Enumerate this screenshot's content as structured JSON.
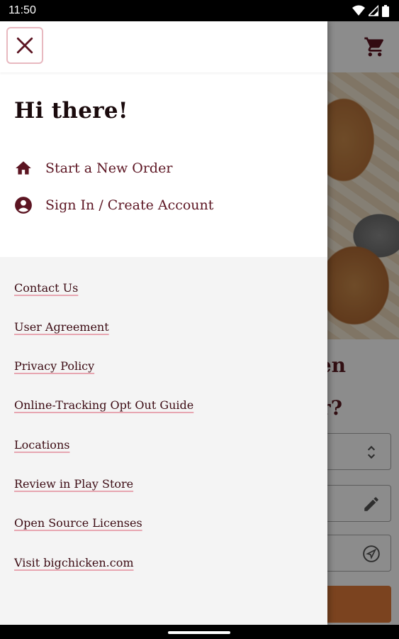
{
  "status_bar": {
    "time": "11:50",
    "icons": [
      "wifi-icon",
      "cellular-signal-icon",
      "battery-icon"
    ]
  },
  "background_app": {
    "icons": [
      "cart-icon",
      "stepper-chevron-icon",
      "pencil-icon",
      "location-arrow-icon"
    ],
    "heading_fragment_1": "en",
    "heading_fragment_2": "r?"
  },
  "drawer": {
    "close_icon": "close-icon",
    "greeting": "Hi there!",
    "primary_items": [
      {
        "icon": "home-icon",
        "label": "Start a New Order"
      },
      {
        "icon": "account-circle-icon",
        "label": "Sign In / Create Account"
      }
    ],
    "links": [
      "Contact Us",
      "User Agreement",
      "Privacy Policy",
      "Online-Tracking Opt Out Guide",
      "Locations",
      "Review in Play Store",
      "Open Source Licenses",
      "Visit bigchicken.com"
    ]
  },
  "colors": {
    "brand_maroon": "#5c1522",
    "link_underline": "#e7a6b1",
    "close_border": "#e8b9c0"
  }
}
